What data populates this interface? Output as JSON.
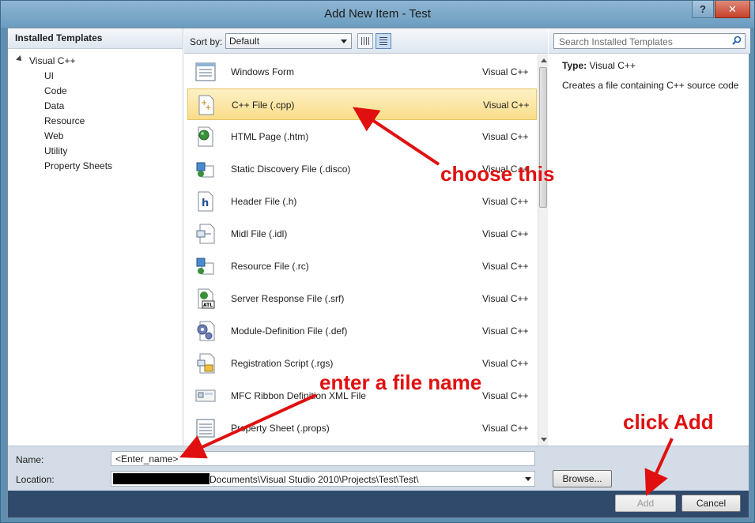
{
  "window": {
    "title": "Add New Item - Test",
    "help_label": "?",
    "close_label": "✕"
  },
  "left": {
    "header": "Installed Templates",
    "root": "Visual C++",
    "items": [
      "UI",
      "Code",
      "Data",
      "Resource",
      "Web",
      "Utility",
      "Property Sheets"
    ]
  },
  "sortbar": {
    "label": "Sort by:",
    "selected": "Default"
  },
  "templates": [
    {
      "name": "Windows Form",
      "lang": "Visual C++",
      "icon": "windows-form-icon"
    },
    {
      "name": "C++ File (.cpp)",
      "lang": "Visual C++",
      "icon": "cpp-file-icon",
      "selected": true
    },
    {
      "name": "HTML Page (.htm)",
      "lang": "Visual C++",
      "icon": "html-page-icon"
    },
    {
      "name": "Static Discovery File (.disco)",
      "lang": "Visual C++",
      "icon": "disco-file-icon"
    },
    {
      "name": "Header File (.h)",
      "lang": "Visual C++",
      "icon": "header-file-icon"
    },
    {
      "name": "Midl File (.idl)",
      "lang": "Visual C++",
      "icon": "midl-file-icon"
    },
    {
      "name": "Resource File (.rc)",
      "lang": "Visual C++",
      "icon": "resource-file-icon"
    },
    {
      "name": "Server Response File (.srf)",
      "lang": "Visual C++",
      "icon": "srf-file-icon"
    },
    {
      "name": "Module-Definition File (.def)",
      "lang": "Visual C++",
      "icon": "def-file-icon"
    },
    {
      "name": "Registration Script (.rgs)",
      "lang": "Visual C++",
      "icon": "rgs-file-icon"
    },
    {
      "name": "MFC Ribbon Definition XML File",
      "lang": "Visual C++",
      "icon": "ribbon-xml-icon"
    },
    {
      "name": "Property Sheet (.props)",
      "lang": "Visual C++",
      "icon": "property-sheet-icon"
    }
  ],
  "search": {
    "placeholder": "Search Installed Templates"
  },
  "details": {
    "type_label": "Type:",
    "type_value": "Visual C++",
    "description": "Creates a file containing C++ source code"
  },
  "form": {
    "name_label": "Name:",
    "name_value": "<Enter_name>",
    "location_label": "Location:",
    "location_value": "Documents\\Visual Studio 2010\\Projects\\Test\\Test\\",
    "browse_label": "Browse...",
    "add_label": "Add",
    "cancel_label": "Cancel"
  },
  "annotations": {
    "choose": "choose this",
    "enter": "enter a file name",
    "click": "click Add",
    "color": "#e01010"
  }
}
